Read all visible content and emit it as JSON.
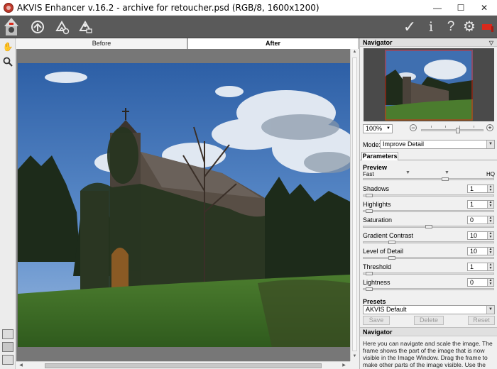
{
  "window": {
    "title": "AKVIS Enhancer v.16.2 - archive for retoucher.psd (RGB/8, 1600x1200)",
    "minimize": "—",
    "maximize": "☐",
    "close": "✕"
  },
  "toolbar": {
    "icons": [
      "akvis-logo-icon",
      "open-image-icon",
      "save-image-icon",
      "batch-icon",
      "apply-check-icon",
      "about-icon",
      "help-icon",
      "settings-icon",
      "notifications-flag-icon"
    ],
    "apply": "✓",
    "about": "i",
    "help": "?",
    "settings": "⚙"
  },
  "tools": {
    "hand": "✋",
    "zoom": "🔍"
  },
  "tabs": {
    "before": "Before",
    "after": "After"
  },
  "navigator": {
    "title": "Navigator",
    "zoom": "100%",
    "zoom_minus": "−",
    "zoom_plus": "+"
  },
  "mode": {
    "label": "Mode:",
    "value": "Improve Detail"
  },
  "parameters": {
    "tab": "Parameters",
    "preview_label": "Preview",
    "fast": "Fast",
    "hq": "HQ",
    "items": [
      {
        "label": "Shadows",
        "value": "1",
        "fraction": 0.02
      },
      {
        "label": "Highlights",
        "value": "1",
        "fraction": 0.02
      },
      {
        "label": "Saturation",
        "value": "0",
        "fraction": 0.5
      },
      {
        "label": "Gradient Contrast",
        "value": "10",
        "fraction": 0.2
      },
      {
        "label": "Level of Detail",
        "value": "10",
        "fraction": 0.2
      },
      {
        "label": "Threshold",
        "value": "1",
        "fraction": 0.02
      },
      {
        "label": "Lightness",
        "value": "0",
        "fraction": 0.02
      }
    ]
  },
  "presets": {
    "label": "Presets",
    "value": "AKVIS Default",
    "save": "Save",
    "delete": "Delete",
    "reset": "Reset"
  },
  "help": {
    "title": "Navigator",
    "text": "Here you can navigate and scale the image. The frame shows the part of the image that is now visible in the Image Window. Drag the frame to make other parts of the image visible. Use the"
  },
  "colors": {
    "toolbar_bg": "#5a5a5a",
    "sky": "#3f6fb0",
    "grass": "#3f6b28",
    "ivy": "#26341f",
    "accent_red": "#d9291c"
  }
}
